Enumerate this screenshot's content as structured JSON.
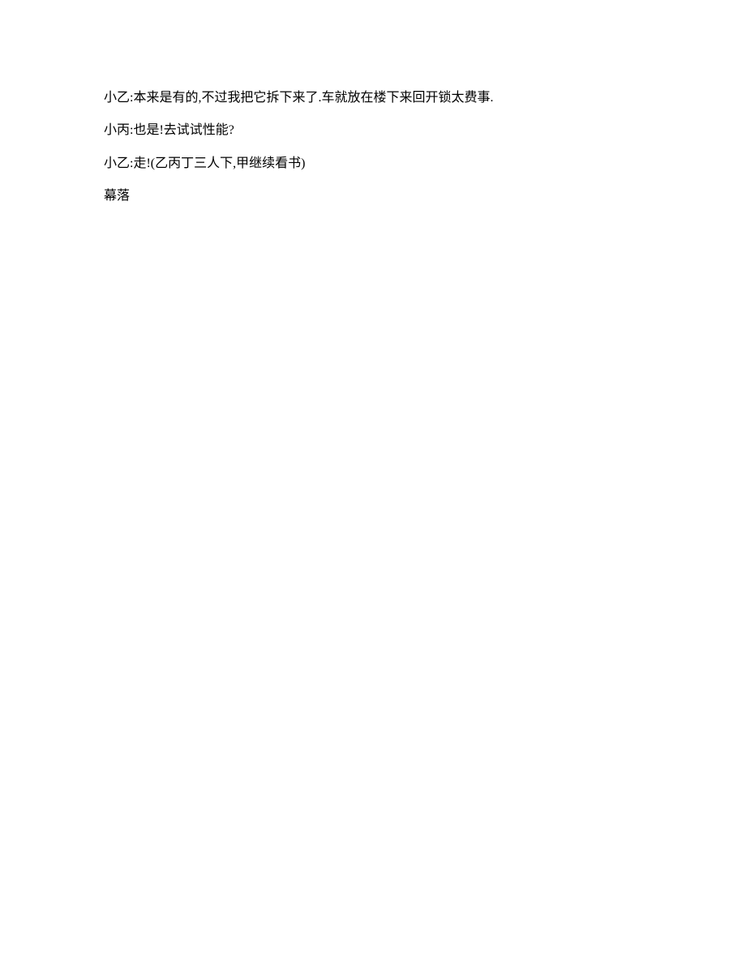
{
  "lines": [
    "小乙:本来是有的,不过我把它拆下来了.车就放在楼下来回开锁太费事.",
    "小丙:也是!去试试性能?",
    "小乙:走!(乙丙丁三人下,甲继续看书)",
    "幕落"
  ]
}
